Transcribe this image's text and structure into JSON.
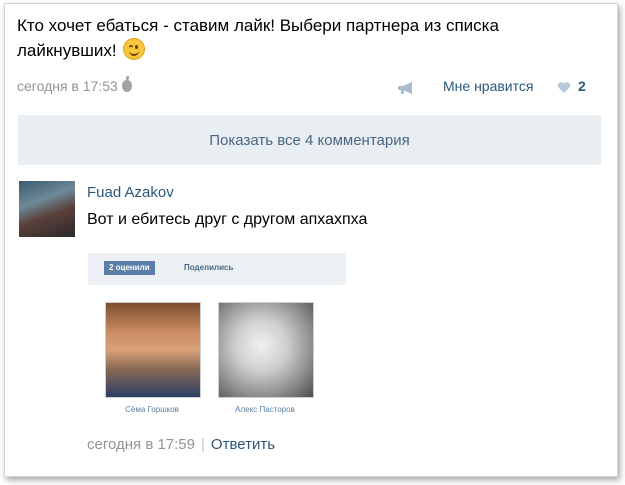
{
  "post": {
    "text": "Кто хочет ебаться - ставим лайк! Выбери партнера из списка лайкнувших!",
    "time": "сегодня в 17:53",
    "like_label": "Мне нравится",
    "like_count": "2"
  },
  "show_comments_label": "Показать все 4 комментария",
  "comment": {
    "author": "Fuad Azakov",
    "text": "Вот и ебитесь друг с другом апхахпха",
    "embed": {
      "tab_active": "2 оценили",
      "tab_other": "Поделились",
      "people": [
        "Сёма Горшков",
        "Алекс Пасторов"
      ]
    },
    "time": "сегодня в 17:59",
    "separator": "|",
    "reply_label": "Ответить"
  },
  "colors": {
    "link": "#2b587a",
    "meta": "#939393",
    "button_bg": "#e9eef2"
  },
  "icons": [
    "wink-emoji",
    "apple-icon",
    "megaphone-icon",
    "heart-icon"
  ]
}
